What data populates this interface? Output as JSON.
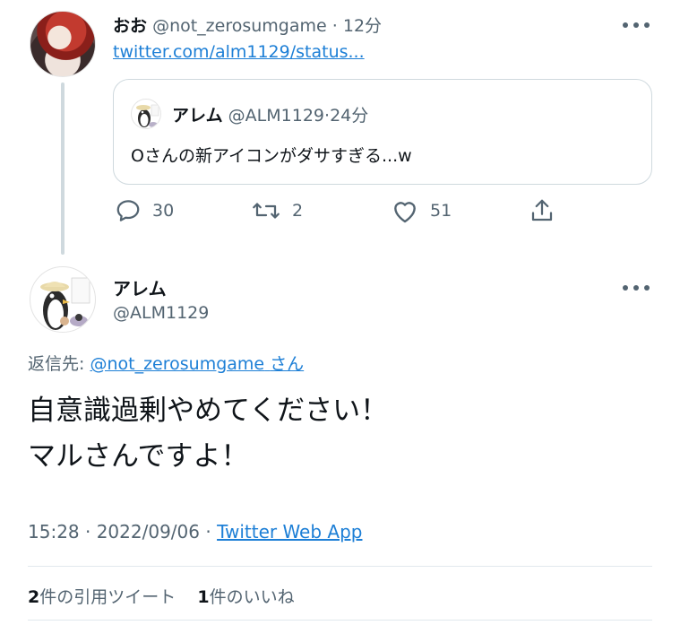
{
  "parent_tweet": {
    "name": "おお",
    "handle": "@not_zerosumgame",
    "separator": "·",
    "time": "12分",
    "link": "twitter.com/alm1129/status...",
    "avatar_icon": "red-haired-character-avatar",
    "quote": {
      "name": "アレム",
      "handle": "@ALM1129",
      "separator": "·",
      "time": "24分",
      "text": "Oさんの新アイコンがダサすぎる...w",
      "avatar_icon": "penguin-avatar"
    },
    "actions": {
      "replies": "30",
      "retweets": "2",
      "likes": "51"
    }
  },
  "main_tweet": {
    "name": "アレム",
    "handle": "@ALM1129",
    "avatar_icon": "penguin-avatar",
    "reply_prefix": "返信先: ",
    "reply_handle": "@not_zerosumgame",
    "reply_suffix": "さん",
    "text_line1": "自意識過剰やめてください！",
    "text_line2": "マルさんですよ！",
    "timestamp": "15:28 · 2022/09/06 · ",
    "source": "Twitter Web App",
    "stats": {
      "quote_count": "2",
      "quote_label": "件の引用ツイート",
      "like_count": "1",
      "like_label": "件のいいね"
    }
  },
  "colors": {
    "link": "#1d7fd6",
    "secondary_text": "#536471",
    "primary_text": "#0f1419",
    "border": "#cfd9de"
  }
}
